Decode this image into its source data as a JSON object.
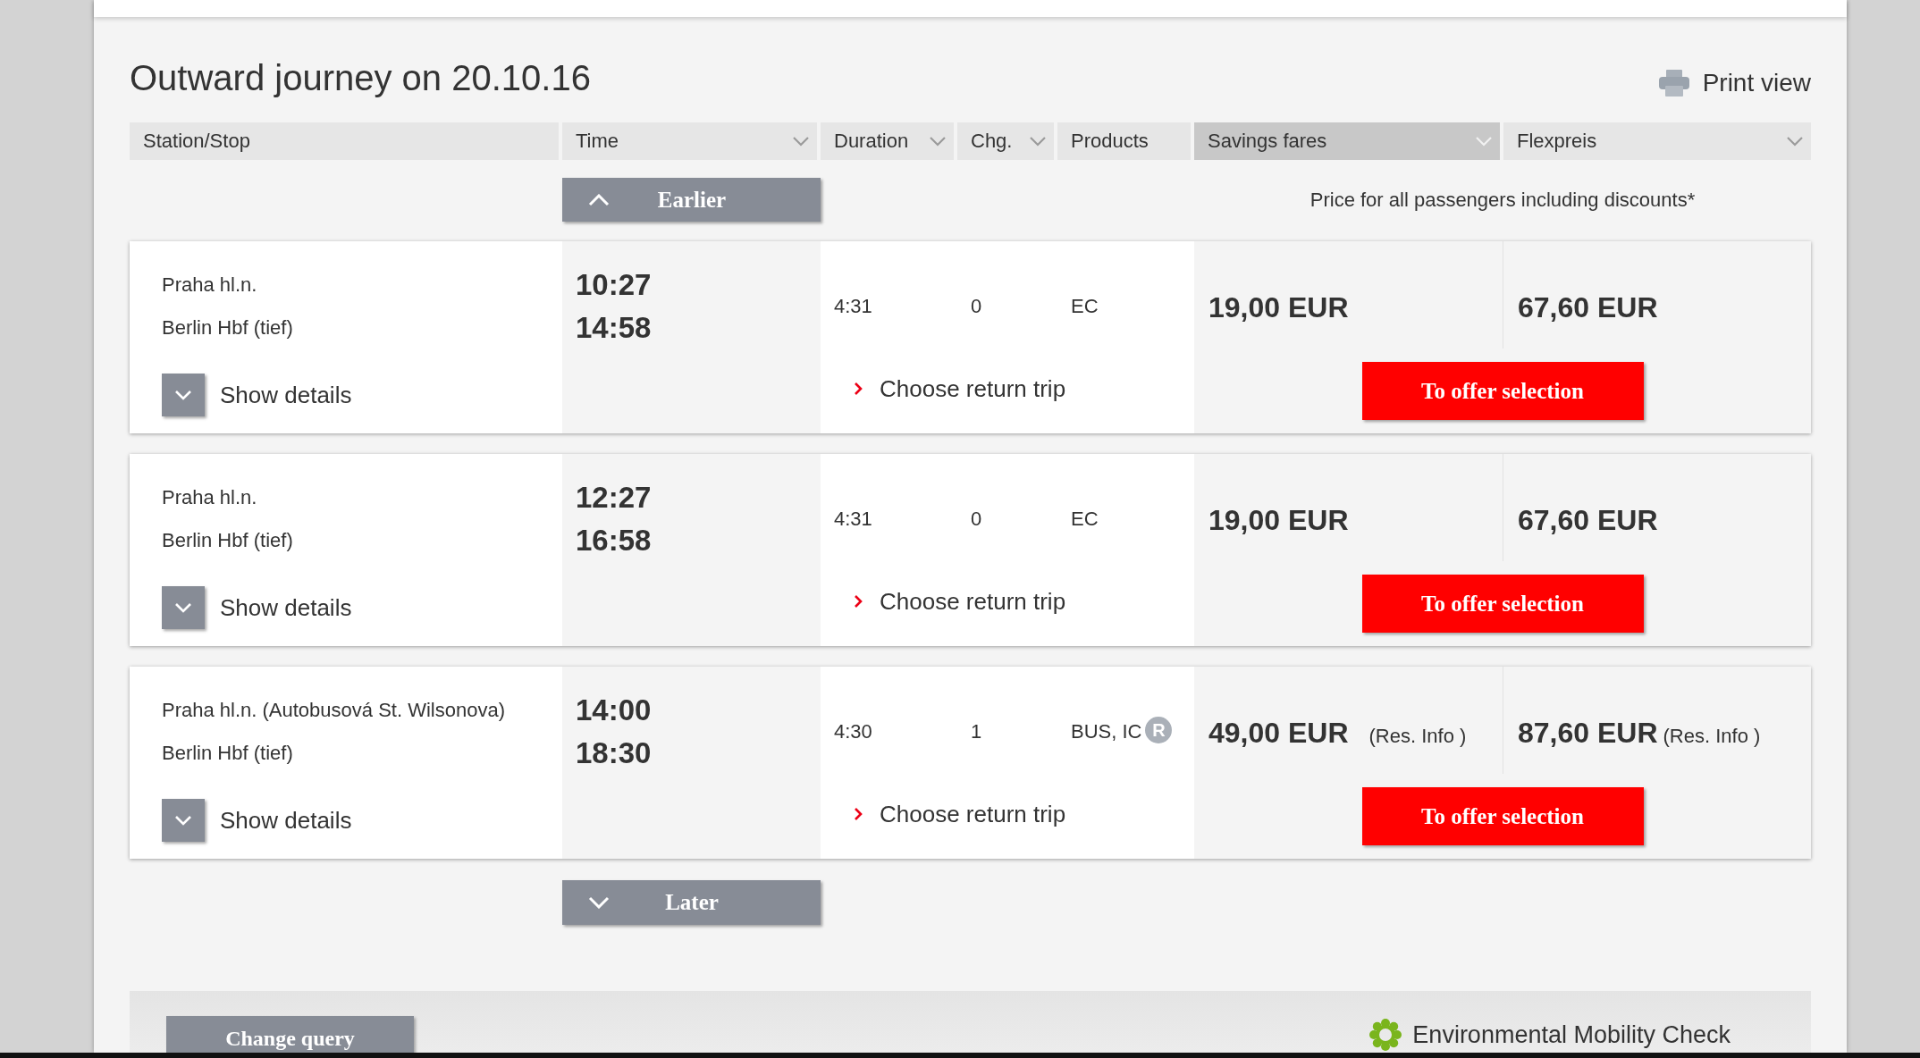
{
  "title": "Outward journey on 20.10.16",
  "print_view": "Print view",
  "columns": [
    {
      "label": "Station/Stop",
      "dropdown": false,
      "selected": false
    },
    {
      "label": "Time",
      "dropdown": true,
      "selected": false
    },
    {
      "label": "Duration",
      "dropdown": true,
      "selected": false
    },
    {
      "label": "Chg.",
      "dropdown": true,
      "selected": false
    },
    {
      "label": "Products",
      "dropdown": false,
      "selected": false
    },
    {
      "label": "Savings fares",
      "dropdown": true,
      "selected": true
    },
    {
      "label": "Flexpreis",
      "dropdown": true,
      "selected": false
    }
  ],
  "earlier_button": "Earlier",
  "price_note": "Price for all passengers including discounts*",
  "connections": [
    {
      "from": "Praha hl.n.",
      "to": "Berlin Hbf (tief)",
      "departure": "10:27",
      "arrival": "14:58",
      "duration": "4:31",
      "changes": "0",
      "products": "EC",
      "details_button": "Show details",
      "return_trip_link": "Choose return trip",
      "savings_fare": {
        "price": "19,00 EUR"
      },
      "flex_fare": {
        "price": "67,60 EUR"
      },
      "offer_button": "To offer selection"
    },
    {
      "from": "Praha hl.n.",
      "to": "Berlin Hbf (tief)",
      "departure": "12:27",
      "arrival": "16:58",
      "duration": "4:31",
      "changes": "0",
      "products": "EC",
      "details_button": "Show details",
      "return_trip_link": "Choose return trip",
      "savings_fare": {
        "price": "19,00 EUR"
      },
      "flex_fare": {
        "price": "67,60 EUR"
      },
      "offer_button": "To offer selection"
    },
    {
      "from": "Praha hl.n. (Autobusová St. Wilsonova)",
      "to": "Berlin Hbf (tief)",
      "departure": "14:00",
      "arrival": "18:30",
      "duration": "4:30",
      "changes": "1",
      "products": "BUS, IC",
      "reservation_mark": "R",
      "details_button": "Show details",
      "return_trip_link": "Choose return trip",
      "savings_fare": {
        "price": "49,00 EUR",
        "note": "(Res. Info )"
      },
      "flex_fare": {
        "price": "87,60 EUR",
        "note": "(Res. Info )"
      },
      "offer_button": "To offer selection"
    }
  ],
  "later_button": "Later",
  "footer": {
    "change_query_button": "Change query",
    "eco_check_link": "Environmental Mobility Check"
  }
}
